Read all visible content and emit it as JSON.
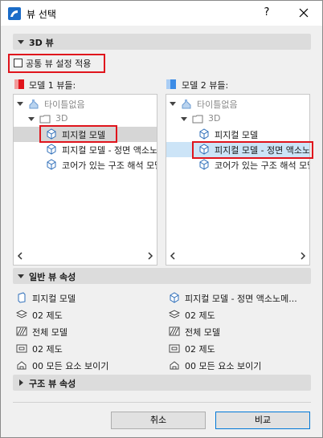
{
  "window": {
    "title": "뷰 선택",
    "help_label": "?"
  },
  "section_3d": {
    "label": "3D 뷰"
  },
  "common_setting": {
    "label": "공통 뷰 설정 적용",
    "checked": false
  },
  "model1": {
    "label": "모델 1 뷰들:",
    "color": "#e0141c",
    "tree": [
      {
        "text": "타이틀없음",
        "dim": true,
        "icon": "untitled-model-icon"
      },
      {
        "text": "3D",
        "dim": true,
        "icon": "folder-icon"
      },
      {
        "text": "피지컬 모델",
        "dim": false,
        "icon": "box-view-icon",
        "selected": true
      },
      {
        "text": "피지컬 모델 - 정면 액소노메트릭",
        "dim": false,
        "icon": "box-view-icon"
      },
      {
        "text": "코어가 있는 구조 해석 모델",
        "dim": false,
        "icon": "box-view-icon"
      }
    ]
  },
  "model2": {
    "label": "모델 2 뷰들:",
    "color": "#3c8ce6",
    "tree": [
      {
        "text": "타이틀없음",
        "dim": true,
        "icon": "untitled-model-icon"
      },
      {
        "text": "3D",
        "dim": true,
        "icon": "folder-icon"
      },
      {
        "text": "피지컬 모델",
        "dim": false,
        "icon": "box-view-icon"
      },
      {
        "text": "피지컬 모델 - 정면 액소노메트릭",
        "dim": false,
        "icon": "box-view-icon",
        "selected": true
      },
      {
        "text": "코어가 있는 구조 해석 모델",
        "dim": false,
        "icon": "box-view-icon"
      }
    ]
  },
  "section_general": {
    "label": "일반 뷰 속성"
  },
  "general_props": {
    "left": [
      {
        "icon": "view-icon",
        "text": "피지컬 모델"
      },
      {
        "icon": "layer-icon",
        "text": "02 제도"
      },
      {
        "icon": "pen-set-icon",
        "text": "전체 모델"
      },
      {
        "icon": "model-view-icon",
        "text": "02 제도"
      },
      {
        "icon": "renovation-icon",
        "text": "00 모든 요소 보이기"
      }
    ],
    "right": [
      {
        "icon": "view-icon",
        "text": "피지컬 모델 - 정면 액소노메..."
      },
      {
        "icon": "layer-icon",
        "text": "02 제도"
      },
      {
        "icon": "pen-set-icon",
        "text": "전체 모델"
      },
      {
        "icon": "model-view-icon",
        "text": "02 제도"
      },
      {
        "icon": "renovation-icon",
        "text": "00 모든 요소 보이기"
      }
    ]
  },
  "section_structural": {
    "label": "구조 뷰 속성"
  },
  "buttons": {
    "cancel": "취소",
    "compare": "비교"
  }
}
